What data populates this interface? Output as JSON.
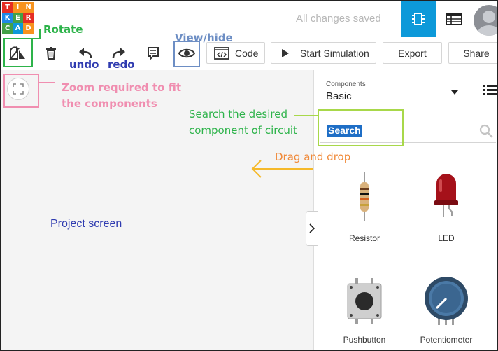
{
  "header": {
    "logo_letters": [
      "TIN",
      "KER",
      "CAD"
    ],
    "logo_colors": [
      "#e52e24",
      "#f7931e",
      "#fbb03b",
      "#1e88e5",
      "#43a047",
      "#0d99d9"
    ],
    "status": "All changes saved",
    "circuit_icon": "circuit-chip-icon",
    "list_icon": "table-list-icon",
    "avatar_icon": "user-avatar-icon"
  },
  "toolbar": {
    "code_label": "Code",
    "simulate_label": "Start Simulation",
    "export_label": "Export",
    "share_label": "Share"
  },
  "panel": {
    "components_caption": "Components",
    "components_value": "Basic",
    "search_value": "Search",
    "items": [
      {
        "label": "Resistor"
      },
      {
        "label": "LED"
      },
      {
        "label": "Pushbutton"
      },
      {
        "label": "Potentiometer"
      }
    ]
  },
  "annotations": {
    "rotate": "Rotate",
    "view_hide": "View/hide",
    "undo": "undo",
    "redo": "redo",
    "zoom_line1": "Zoom required to fit",
    "zoom_line2": "the components",
    "search_line1": "Search the desired",
    "search_line2": "component of circuit",
    "drag_drop": "Drag and drop",
    "project_screen": "Project screen",
    "colors": {
      "green": "#2db34a",
      "blue": "#6d8ec4",
      "navy": "#2f3bb0",
      "pink": "#f08eb0",
      "lime": "#a8d84a",
      "orange": "#f08a3a",
      "arrow": "#f5b92a"
    }
  }
}
